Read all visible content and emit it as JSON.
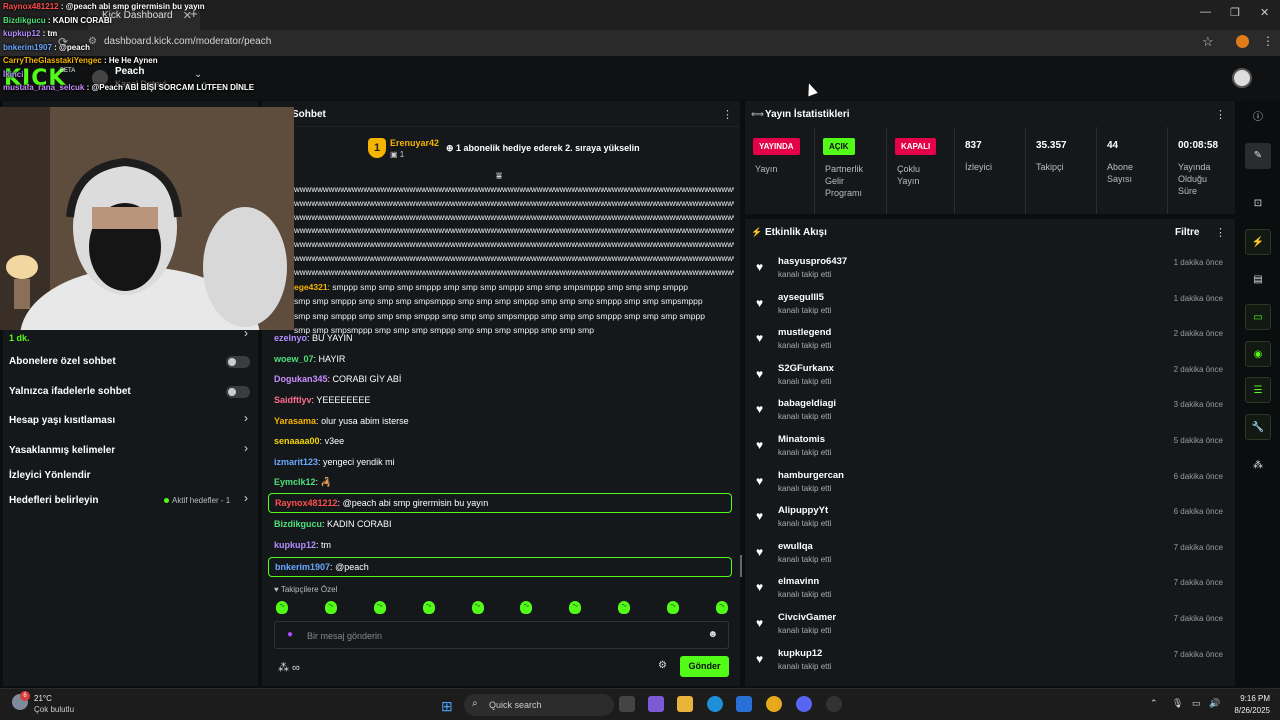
{
  "browser": {
    "tab_title": "Kick Dashboard",
    "url": "dashboard.kick.com/moderator/peach"
  },
  "header": {
    "logo": "KICK",
    "beta": "BETA",
    "channel_name": "Peach",
    "channel_sub": "Kanal Detayl"
  },
  "overlay_chat": [
    {
      "user": "Raynox481212",
      "text": "@peach abi smp girermisin bu yayın",
      "color": "#ff4d4d"
    },
    {
      "user": "Bizdikgucu",
      "text": "KADIN CORABI",
      "color": "#4ee07a"
    },
    {
      "user": "kupkup12",
      "text": "tm",
      "color": "#b48cff"
    },
    {
      "user": "bnkerim1907",
      "text": "@peach",
      "color": "#6aa8ff"
    },
    {
      "user": "CarryTheGlasstakiYengec",
      "text": "He He Aynen",
      "color": "#f5b400"
    },
    {
      "user": "İkinci",
      "text": "",
      "color": "#b48cff"
    },
    {
      "user": "mustafa_rana_selcuk",
      "text": "@Peach ABİ BİŞİ SORCAM LÜTFEN DİNLE",
      "color": "#c98cff"
    }
  ],
  "left_panel": {
    "slow_mode_value": "1 dk.",
    "items": [
      {
        "label": "Abonelere özel sohbet",
        "type": "toggle"
      },
      {
        "label": "Yalnızca ifadelerle sohbet",
        "type": "toggle"
      },
      {
        "label": "Hesap yaşı kısıtlaması",
        "type": "chevron"
      },
      {
        "label": "Yasaklanmış kelimeler",
        "type": "chevron"
      },
      {
        "label": "İzleyici Yönlendir",
        "type": "none"
      },
      {
        "label": "Hedefleri belirleyin",
        "type": "goal"
      }
    ],
    "goal_status": "Aktif hedefler - 1"
  },
  "chat": {
    "title": "Sohbet",
    "pinned": {
      "rank": "1",
      "user": "Erenuyar42",
      "count": "1",
      "message": "1 abonelik hediye ederek 2. sıraya yükselin"
    },
    "spam_lines": [
      "wwwwwwwwwwwwwwwwwwwwwwwwwwwwwwwwwwwwwwwwwwwwwwwwwwwwwwwwwwwwwwwwwwwwwwwwwwwwwwwwwwwwwwww",
      "wwwwwwwwwwwwwwwwwwwwwwwwwwwwwwwwwwwwwwwwwwwwwwwwwwwwwwwwwwwwwwwwwwwwwwwwwwwwwwwwwwwwwwww",
      "wwwwwwwwwwwwwwwwwwwwwwwwwwwwwwwwwwwwwwwwwwwwwwwwwwwwwwwwwwwwwwwwwwwwwwwwwwwwwwwwwwwwwwww",
      "wwwwwwwwwwwwwwwwwwwwwwwwwwwwwwwwwwwwwwwwwwwwwwwwwwwwwwwwwwwwwwwwwwwwwwwwwwwwwwwwwwwwwwww",
      "wwwwwwwwwwwwwwwwwwwwwwwwwwwwwwwwwwwwwwwwwwwwwwwwwwwwwwwwwwwwwwwwwwwwwwwwwwwwwwwwwwwwwwww",
      "wwwwwwwwwwwwwwwwwwwwwwwwwwwwwwwwwwwwwwwwwwwwwwwwwwwwwwwwwwwwwwwwwwwwwwwwwwwwwwwwwwwwwwww",
      "wwwwwwwwwwwwwwwwwwwwwwwwwwwwwwwwwwwwwwwwwwwwwwwwwwwwwwwwwwwwwwwwwwwwwwwwwwwwwwww"
    ],
    "smp_user": "ege4321",
    "smp_lines": [
      "smppp smp smp smp smppp smp smp smp smppp smp smp smpsmppp smp smp smp smppp",
      "smp smp smppp smp smp smp smpsmppp smp smp smp smppp smp smp smp smppp smp smp smpsmppp",
      "smp smp smppp smp smp smp smppp smp smp smp smpsmppp smp smp smp smppp smp smp smp smppp",
      "smp smp smpsmppp smp smp smp smppp smp smp smp smppp smp smp smp"
    ],
    "messages": [
      {
        "user": "ezelnyo",
        "text": "BU YAYIN",
        "color": "#b48cff",
        "hl": false
      },
      {
        "user": "woew_07",
        "text": "HAYIR",
        "color": "#4ee07a",
        "hl": false
      },
      {
        "user": "Dogukan345",
        "text": "CORABI GİY ABİ",
        "color": "#c98cff",
        "hl": false
      },
      {
        "user": "Saidftlyv",
        "text": "YEEEEEEEE",
        "color": "#ff6b8a",
        "hl": false
      },
      {
        "user": "Yarasama",
        "text": "olur yusa abim isterse",
        "color": "#f5b400",
        "hl": false
      },
      {
        "user": "senaaaa00",
        "text": "v3ee",
        "color": "#f5d400",
        "hl": false
      },
      {
        "user": "izmarit123",
        "text": "yengeci yendik mi",
        "color": "#6aa8ff",
        "hl": false
      },
      {
        "user": "Eymclk12",
        "text": "",
        "color": "#4ee07a",
        "hl": false
      },
      {
        "user": "Raynox481212",
        "text": "@peach abi smp girermisin bu yayın",
        "color": "#ff4d4d",
        "hl": true
      },
      {
        "user": "Bizdikgucu",
        "text": "KADIN CORABI",
        "color": "#4ee07a",
        "hl": false
      },
      {
        "user": "kupkup12",
        "text": "tm",
        "color": "#b48cff",
        "hl": false
      },
      {
        "user": "bnkerim1907",
        "text": "@peach",
        "color": "#6aa8ff",
        "hl": true
      }
    ],
    "followers_only": "Takipçilere Özel",
    "input_placeholder": "Bir mesaj gönderin",
    "send_label": "Gönder"
  },
  "stats": {
    "title": "Yayın İstatistikleri",
    "items": [
      {
        "badge": "YAYINDA",
        "badge_color": "#e5004a",
        "badge_text_color": "#fff",
        "label": "Yayın"
      },
      {
        "badge": "AÇIK",
        "badge_color": "#53fc18",
        "badge_text_color": "#0b0e0f",
        "label": "Partnerlik Gelir Programı"
      },
      {
        "badge": "KAPALI",
        "badge_color": "#e5004a",
        "badge_text_color": "#fff",
        "label": "Çoklu Yayın"
      },
      {
        "value": "837",
        "label": "İzleyici"
      },
      {
        "value": "35.357",
        "label": "Takipçi"
      },
      {
        "value": "44",
        "label": "Abone Sayısı"
      },
      {
        "value": "00:08:58",
        "label": "Yayında Olduğu Süre"
      }
    ]
  },
  "activity": {
    "title": "Etkinlik Akışı",
    "filter_label": "Filtre",
    "events": [
      {
        "user": "hasyuspro6437",
        "action": "kanalı takip etti",
        "time": "1 dakika önce"
      },
      {
        "user": "aysegulll5",
        "action": "kanalı takip etti",
        "time": "1 dakika önce"
      },
      {
        "user": "mustlegend",
        "action": "kanalı takip etti",
        "time": "2 dakika önce"
      },
      {
        "user": "S2GFurkanx",
        "action": "kanalı takip etti",
        "time": "2 dakika önce"
      },
      {
        "user": "babageldiagi",
        "action": "kanalı takip etti",
        "time": "3 dakika önce"
      },
      {
        "user": "Minatomis",
        "action": "kanalı takip etti",
        "time": "5 dakika önce"
      },
      {
        "user": "hamburgercan",
        "action": "kanalı takip etti",
        "time": "6 dakika önce"
      },
      {
        "user": "AlipuppyYt",
        "action": "kanalı takip etti",
        "time": "6 dakika önce"
      },
      {
        "user": "ewullqa",
        "action": "kanalı takip etti",
        "time": "7 dakika önce"
      },
      {
        "user": "elmavinn",
        "action": "kanalı takip etti",
        "time": "7 dakika önce"
      },
      {
        "user": "CivcivGamer",
        "action": "kanalı takip etti",
        "time": "7 dakika önce"
      },
      {
        "user": "kupkup12",
        "action": "kanalı takip etti",
        "time": "7 dakika önce"
      }
    ]
  },
  "taskbar": {
    "weather_temp": "21°C",
    "weather_cond": "Çok bulutlu",
    "weather_badge": "6",
    "search_placeholder": "Quick search",
    "time": "9:16 PM",
    "date": "8/26/2025"
  },
  "colors": {
    "accent": "#53fc18",
    "live": "#e5004a",
    "panel": "#15181a",
    "background": "#0b0e0f"
  }
}
